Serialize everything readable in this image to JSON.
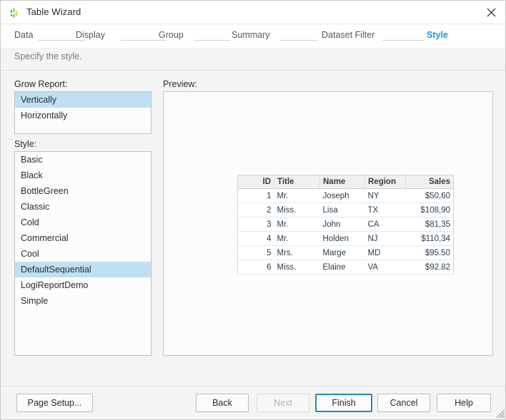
{
  "window": {
    "title": "Table Wizard",
    "icon": "bar-chart-icon",
    "close_label": "×",
    "accent_color": "#2196d8",
    "selection_color": "#bfe0f2"
  },
  "steps": [
    {
      "label": "Data",
      "current": false
    },
    {
      "label": "Display",
      "current": false
    },
    {
      "label": "Group",
      "current": false
    },
    {
      "label": "Summary",
      "current": false
    },
    {
      "label": "Dataset Filter",
      "current": false
    },
    {
      "label": "Style",
      "current": true
    }
  ],
  "instruction": "Specify the style.",
  "grow_report": {
    "label": "Grow Report:",
    "items": [
      {
        "label": "Vertically",
        "selected": true
      },
      {
        "label": "Horizontally",
        "selected": false
      }
    ]
  },
  "style": {
    "label": "Style:",
    "items": [
      {
        "label": "Basic",
        "selected": false
      },
      {
        "label": "Black",
        "selected": false
      },
      {
        "label": "BottleGreen",
        "selected": false
      },
      {
        "label": "Classic",
        "selected": false
      },
      {
        "label": "Cold",
        "selected": false
      },
      {
        "label": "Commercial",
        "selected": false
      },
      {
        "label": "Cool",
        "selected": false
      },
      {
        "label": "DefaultSequential",
        "selected": true
      },
      {
        "label": "LogiReportDemo",
        "selected": false
      },
      {
        "label": "Simple",
        "selected": false
      }
    ]
  },
  "preview": {
    "label": "Preview:",
    "table": {
      "columns": [
        "ID",
        "Title",
        "Name",
        "Region",
        "Sales"
      ],
      "rows": [
        [
          "1",
          "Mr.",
          "Joseph",
          "NY",
          "$50,60"
        ],
        [
          "2",
          "Miss.",
          "Lisa",
          "TX",
          "$108,90"
        ],
        [
          "3",
          "Mr.",
          "John",
          "CA",
          "$81,35"
        ],
        [
          "4",
          "Mr.",
          "Holden",
          "NJ",
          "$110,34"
        ],
        [
          "5",
          "Mrs.",
          "Marge",
          "MD",
          "$95.50"
        ],
        [
          "6",
          "Miss.",
          "Elaine",
          "VA",
          "$92.82"
        ]
      ]
    }
  },
  "footer": {
    "page_setup": "Page Setup...",
    "back": "Back",
    "next": "Next",
    "finish": "Finish",
    "cancel": "Cancel",
    "help": "Help"
  }
}
